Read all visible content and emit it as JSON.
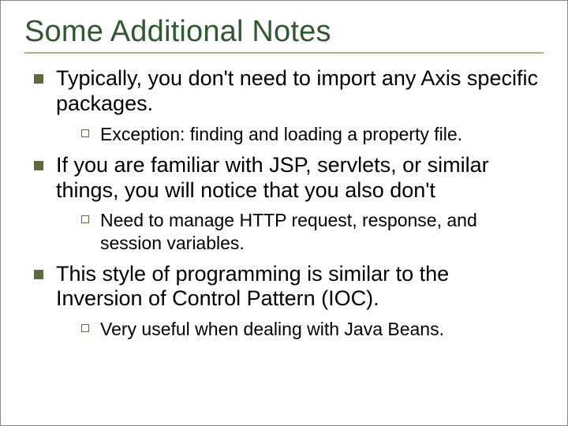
{
  "title": "Some Additional Notes",
  "bullets": [
    {
      "text": "Typically, you don't need to import any Axis specific packages.",
      "sub": [
        {
          "text": "Exception: finding and loading a property file."
        }
      ]
    },
    {
      "text": "If you are familiar with JSP, servlets, or similar things, you will notice that you also don't",
      "sub": [
        {
          "text": "Need to manage HTTP request, response, and session variables."
        }
      ]
    },
    {
      "text": "This style of programming is similar to the Inversion of Control Pattern (IOC).",
      "sub": [
        {
          "text": "Very useful when dealing with Java Beans."
        }
      ]
    }
  ]
}
